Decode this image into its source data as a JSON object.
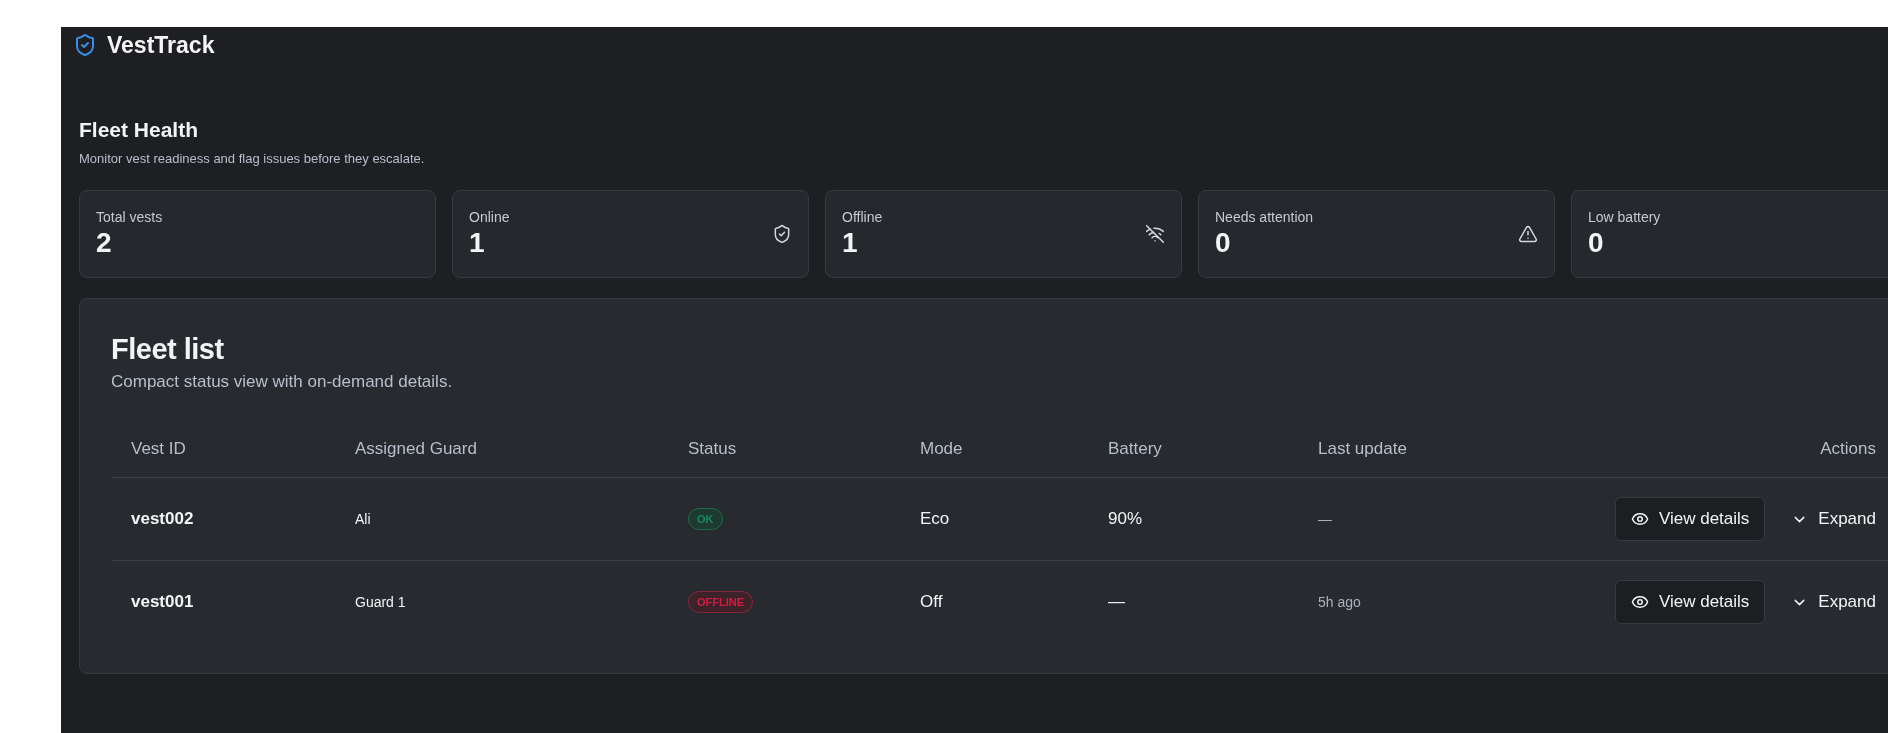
{
  "app": {
    "name": "VestTrack"
  },
  "header": {
    "title": "Fleet Health",
    "subtitle": "Monitor vest readiness and flag issues before they escalate."
  },
  "stats": [
    {
      "label": "Total vests",
      "value": "2",
      "kind": "total"
    },
    {
      "label": "Online",
      "value": "1",
      "kind": "online"
    },
    {
      "label": "Offline",
      "value": "1",
      "kind": "offline"
    },
    {
      "label": "Needs attention",
      "value": "0",
      "kind": "attention"
    },
    {
      "label": "Low battery",
      "value": "0",
      "kind": "battery"
    }
  ],
  "fleet_list": {
    "title": "Fleet list",
    "subtitle": "Compact status view with on-demand details.",
    "columns": [
      "Vest ID",
      "Assigned Guard",
      "Status",
      "Mode",
      "Battery",
      "Last update",
      "Actions"
    ],
    "rows": [
      {
        "vest_id": "vest002",
        "guard": "Ali",
        "status": {
          "label": "OK",
          "kind": "ok"
        },
        "mode": "Eco",
        "battery": "90%",
        "last_update": "—",
        "view_button": "View details",
        "expand_button": "Expand"
      },
      {
        "vest_id": "vest001",
        "guard": "Guard 1",
        "status": {
          "label": "OFFLINE",
          "kind": "offline"
        },
        "mode": "Off",
        "battery": "—",
        "last_update": "5h ago",
        "view_button": "View details",
        "expand_button": "Expand"
      }
    ]
  }
}
